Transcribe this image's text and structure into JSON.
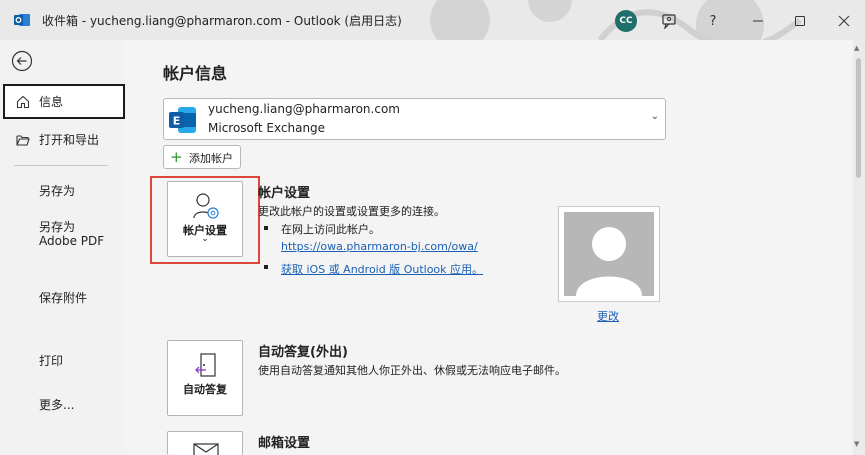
{
  "window": {
    "title": "收件箱 - yucheng.liang@pharmaron.com  -  Outlook (启用日志)",
    "avatar_initials": "CC",
    "icons": [
      "outlook-icon",
      "feedback-icon",
      "help-icon",
      "minimize-icon",
      "maximize-icon",
      "close-icon"
    ]
  },
  "sidebar": {
    "items": [
      {
        "label": "信息",
        "icon": "home-icon",
        "active": true
      },
      {
        "label": "打开和导出",
        "icon": "folder-open-icon"
      },
      {
        "label": "另存为"
      },
      {
        "label": "另存为\nAdobe PDF"
      },
      {
        "label": "保存附件"
      },
      {
        "label": "打印"
      },
      {
        "label": "更多..."
      }
    ]
  },
  "main": {
    "page_title": "帐户信息",
    "account": {
      "email": "yucheng.liang@pharmaron.com",
      "type": "Microsoft Exchange"
    },
    "add_account_label": "添加帐户",
    "account_settings": {
      "tile_label": "帐户设置",
      "title": "帐户设置",
      "description": "更改此帐户的设置或设置更多的连接。",
      "bullet1": "在网上访问此帐户。",
      "link1": "https://owa.pharmaron-bj.com/owa/",
      "link2": "获取 iOS 或 Android 版 Outlook 应用。"
    },
    "photo_change_label": "更改",
    "auto_reply": {
      "tile_label": "自动答复",
      "title": "自动答复(外出)",
      "description": "使用自动答复通知其他人你正外出、休假或无法响应电子邮件。"
    },
    "mailbox_settings": {
      "title": "邮箱设置"
    }
  },
  "colors": {
    "accent_link": "#1a5fb4",
    "highlight": "#e0453a",
    "avatar_bg": "#1f6f6a"
  }
}
